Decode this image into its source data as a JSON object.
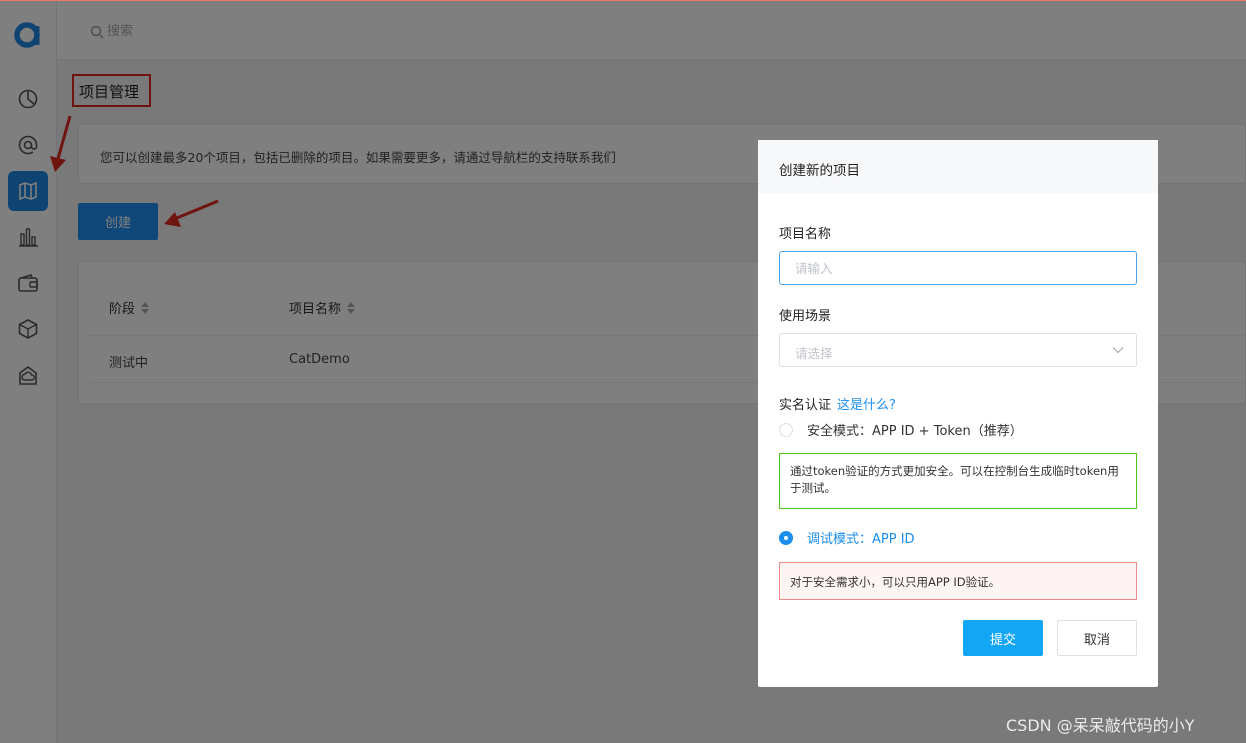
{
  "search": {
    "placeholder": "搜索"
  },
  "page": {
    "title": "项目管理",
    "notice": "您可以创建最多20个项目，包括已删除的项目。如果需要更多，请通过导航栏的支持联系我们",
    "create_label": "创建"
  },
  "table": {
    "columns": [
      "阶段",
      "项目名称"
    ],
    "rows": [
      {
        "stage": "测试中",
        "name": "CatDemo"
      }
    ]
  },
  "sidebar": {
    "items": [
      {
        "icon": "dashboard-icon"
      },
      {
        "icon": "at-icon"
      },
      {
        "icon": "map-icon",
        "active": true
      },
      {
        "icon": "bar-chart-icon"
      },
      {
        "icon": "wallet-icon"
      },
      {
        "icon": "cube-icon"
      },
      {
        "icon": "cloud-box-icon"
      }
    ]
  },
  "modal": {
    "title": "创建新的项目",
    "name_label": "项目名称",
    "name_placeholder": "请输入",
    "scene_label": "使用场景",
    "scene_placeholder": "请选择",
    "auth_label": "实名认证",
    "auth_help": "这是什么?",
    "option_secure": "安全模式：APP ID + Token（推荐）",
    "option_secure_tip": "通过token验证的方式更加安全。可以在控制台生成临时token用于测试。",
    "option_debug": "调试模式：APP ID",
    "option_debug_tip": "对于安全需求小，可以只用APP ID验证。",
    "submit_label": "提交",
    "cancel_label": "取消"
  },
  "watermark": "CSDN @呆呆敲代码的小Y",
  "colors": {
    "primary": "#1c8ef0",
    "annotation": "#e0281f"
  }
}
